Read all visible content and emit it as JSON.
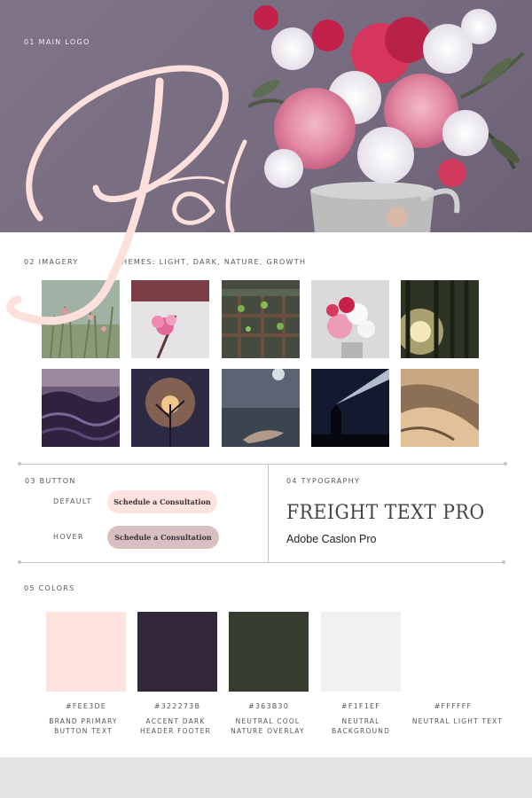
{
  "hero": {
    "label": "01 MAIN LOGO",
    "logo_text": "Pd",
    "logo_color": "#fde0dc"
  },
  "imagery": {
    "label": "02 IMAGERY",
    "themes": "THEMES: LIGHT, DARK, NATURE, GROWTH",
    "images": [
      {
        "name": "grass-meadow"
      },
      {
        "name": "pink-blossom"
      },
      {
        "name": "seedling-sprouts"
      },
      {
        "name": "flower-bouquet"
      },
      {
        "name": "sunlit-forest"
      },
      {
        "name": "dark-waves"
      },
      {
        "name": "backlit-plant"
      },
      {
        "name": "hand-dandelion"
      },
      {
        "name": "night-sky-flashlight"
      },
      {
        "name": "sand-dunes"
      }
    ]
  },
  "button": {
    "label": "03 BUTTON",
    "default_label": "DEFAULT",
    "hover_label": "HOVER",
    "cta_text": "Schedule a Consultation"
  },
  "typography": {
    "label": "04 TYPOGRAPHY",
    "primary_font": "FREIGHT TEXT PRO",
    "secondary_font": "Adobe Caslon Pro"
  },
  "colors": {
    "label": "05 COLORS",
    "swatches": [
      {
        "hex": "#FEE3DE",
        "desc": "BRAND PRIMARY BUTTON TEXT",
        "color": "#fee3de"
      },
      {
        "hex": "#322273B",
        "desc": "ACCENT DARK HEADER FOOTER",
        "color": "#322738"
      },
      {
        "hex": "#363B30",
        "desc": "NEUTRAL COOL NATURE OVERLAY",
        "color": "#363b30"
      },
      {
        "hex": "#F1F1EF",
        "desc": "NEUTRAL BACKGROUND",
        "color": "#f1f1ef"
      },
      {
        "hex": "#FFFFFF",
        "desc": "NEUTRAL LIGHT TEXT",
        "color": "#ffffff"
      }
    ]
  }
}
